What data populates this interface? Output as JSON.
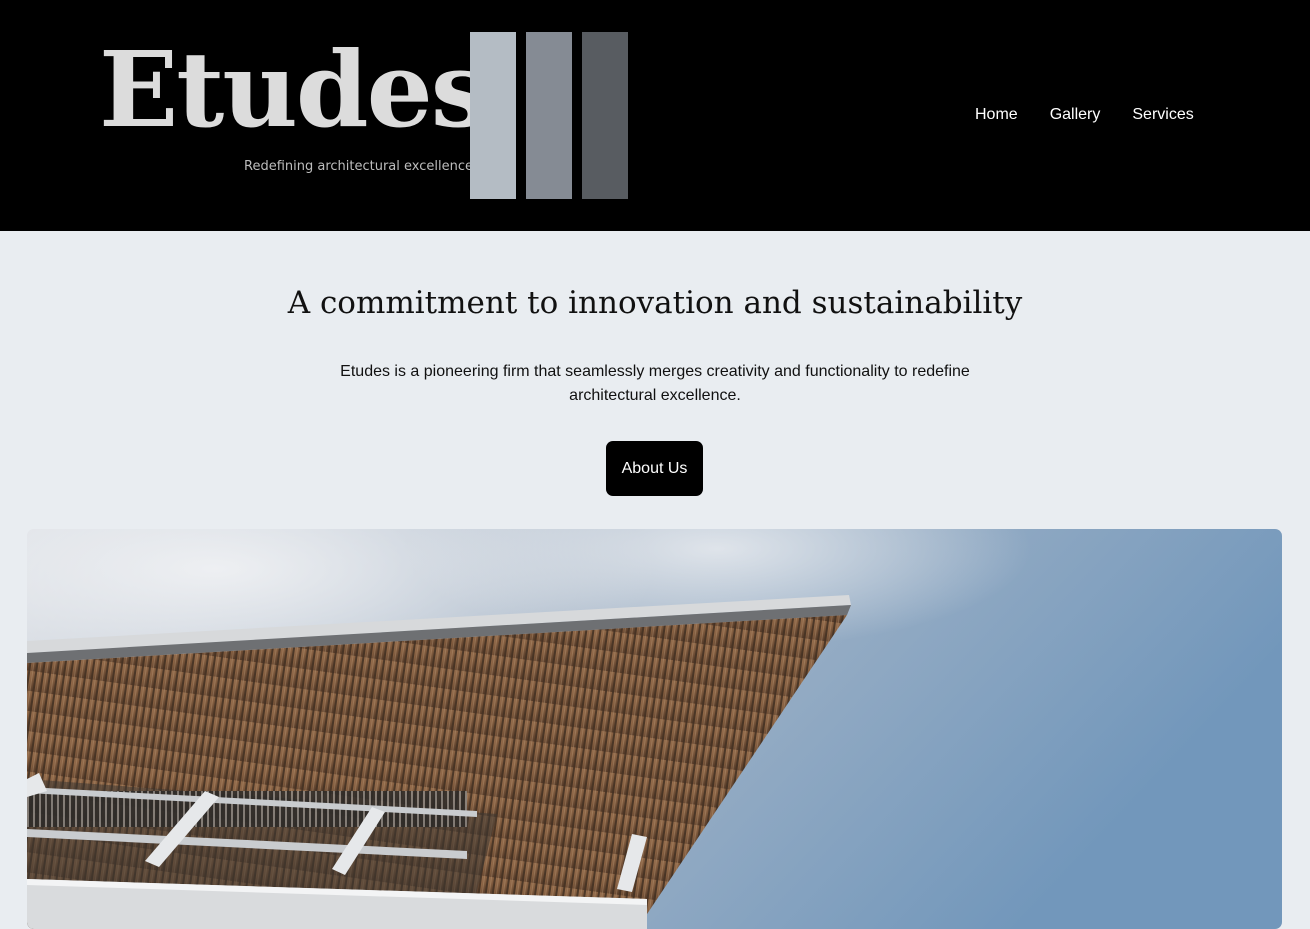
{
  "brand": {
    "name": "Etudes",
    "tagline": "Redefining architectural excellence",
    "bar_colors": [
      "#b4bcc4",
      "#858b94",
      "#585c61"
    ]
  },
  "nav": {
    "home": "Home",
    "gallery": "Gallery",
    "services": "Services"
  },
  "hero": {
    "title": "A commitment to innovation and sustainability",
    "description": "Etudes is a pioneering firm that seamlessly merges creativity and functionality to redefine architectural excellence.",
    "cta_label": "About Us"
  },
  "colors": {
    "header_bg": "#000000",
    "page_bg": "#e9edf1",
    "button_bg": "#000000",
    "button_text": "#ffffff"
  },
  "photo": {
    "subject": "building-canopy-photo"
  }
}
